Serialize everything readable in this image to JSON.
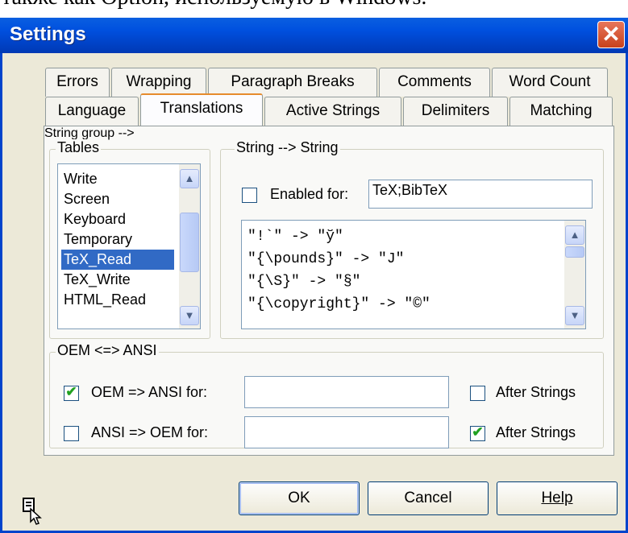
{
  "doc_fragment": "также как Option, используемую в Windows.",
  "dialog": {
    "title": "Settings"
  },
  "tabs_row1": [
    "Errors",
    "Wrapping",
    "Paragraph Breaks",
    "Comments",
    "Word Count"
  ],
  "tabs_row2": [
    "Language",
    "Translations",
    "Active Strings",
    "Delimiters",
    "Matching"
  ],
  "active_tab": "Translations",
  "tables": {
    "label": "Tables",
    "items": [
      "Write",
      "Screen",
      "Keyboard",
      "Temporary",
      "TeX_Read",
      "TeX_Write",
      "HTML_Read"
    ],
    "selected": "TeX_Read"
  },
  "string_group": {
    "label": "String --> String",
    "enabled_label": "Enabled for:",
    "enabled_checked": false,
    "enabled_value": "TeX;BibTeX",
    "mappings": [
      "\"!`\" -> \"ў\"",
      "\"{\\pounds}\" -> \"J\"",
      "\"{\\S}\" -> \"§\"",
      "\"{\\copyright}\" -> \"©\""
    ]
  },
  "oem_group": {
    "label": "OEM <=> ANSI",
    "row1": {
      "label": "OEM => ANSI  for:",
      "checked": true,
      "value": "",
      "after_label": "After Strings",
      "after_checked": false
    },
    "row2": {
      "label": "ANSI => OEM  for:",
      "checked": false,
      "value": "",
      "after_label": "After Strings",
      "after_checked": true
    }
  },
  "buttons": {
    "ok": "OK",
    "cancel": "Cancel",
    "help": "Help"
  },
  "colors": {
    "title_bar": "#0050df",
    "selection": "#316ac5",
    "close_button": "#c8421c"
  }
}
